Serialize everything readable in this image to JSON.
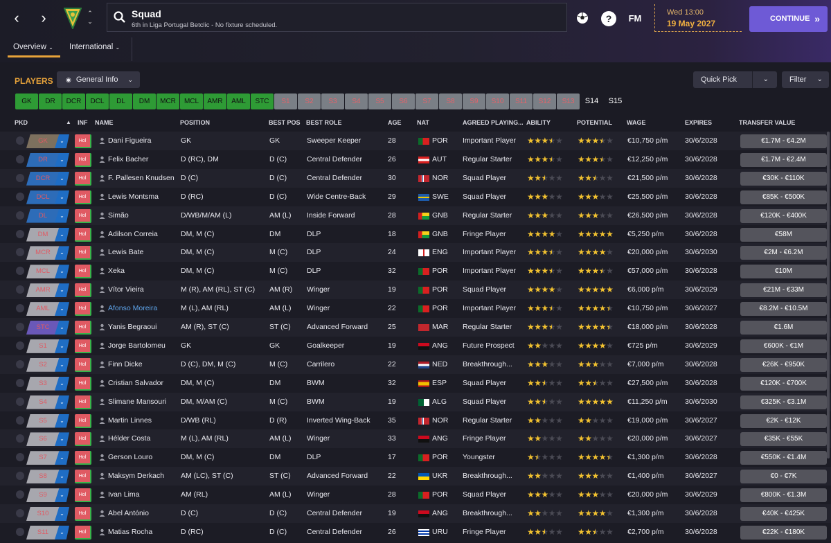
{
  "header": {
    "title": "Squad",
    "subtitle": "6th in Liga Portugal Betclic - No fixture scheduled.",
    "date_line1": "Wed 13:00",
    "date_line2": "19 May 2027",
    "continue_label": "CONTINUE",
    "fm_label": "FM",
    "help_label": "?"
  },
  "subtabs": {
    "overview": "Overview",
    "international": "International"
  },
  "section": {
    "title": "PLAYERS",
    "view_label": "General Info",
    "quickpick_label": "Quick Pick",
    "filter_label": "Filter"
  },
  "colors": {
    "accent": "#e8a33a",
    "continue": "#6e5ad6",
    "chip_green": "#2e9b35",
    "chip_red": "#d2585e",
    "chip_grey": "#7a7f86",
    "star_gold": "#f2c230",
    "star_grey": "#4a4a54"
  },
  "position_chips": [
    {
      "label": "GK",
      "state": "green"
    },
    {
      "label": "DR",
      "state": "green"
    },
    {
      "label": "DCR",
      "state": "green"
    },
    {
      "label": "DCL",
      "state": "green"
    },
    {
      "label": "DL",
      "state": "green"
    },
    {
      "label": "DM",
      "state": "green"
    },
    {
      "label": "MCR",
      "state": "green"
    },
    {
      "label": "MCL",
      "state": "green"
    },
    {
      "label": "AMR",
      "state": "green"
    },
    {
      "label": "AML",
      "state": "green"
    },
    {
      "label": "STC",
      "state": "green"
    },
    {
      "label": "S1",
      "state": "grey"
    },
    {
      "label": "S2",
      "state": "grey"
    },
    {
      "label": "S3",
      "state": "grey"
    },
    {
      "label": "S4",
      "state": "grey"
    },
    {
      "label": "S5",
      "state": "grey"
    },
    {
      "label": "S6",
      "state": "grey"
    },
    {
      "label": "S7",
      "state": "grey"
    },
    {
      "label": "S8",
      "state": "grey"
    },
    {
      "label": "S9",
      "state": "grey"
    },
    {
      "label": "S10",
      "state": "grey"
    },
    {
      "label": "S11",
      "state": "grey"
    },
    {
      "label": "S12",
      "state": "grey"
    },
    {
      "label": "S13",
      "state": "grey"
    },
    {
      "label": "S14",
      "state": "dark"
    },
    {
      "label": "S15",
      "state": "dark"
    }
  ],
  "table": {
    "columns": [
      "PKD",
      "INF",
      "NAME",
      "POSITION",
      "BEST POS",
      "BEST ROLE",
      "AGE",
      "NAT",
      "AGREED PLAYING...",
      "ABILITY",
      "POTENTIAL",
      "WAGE",
      "EXPIRES",
      "TRANSFER VALUE"
    ],
    "rows": [
      {
        "pkd": "GK",
        "pkd_color": "#7d705e",
        "inf": "Hol",
        "name": "Dani Figueira",
        "position": "GK",
        "best_pos": "GK",
        "best_role": "Sweeper Keeper",
        "age": "28",
        "nat": "POR",
        "playing": "Important Player",
        "ability": 3.5,
        "potential": 3.5,
        "wage": "€10,750 p/m",
        "expires": "30/6/2028",
        "value": "€1.7M - €4.2M"
      },
      {
        "pkd": "DR",
        "pkd_color": "#2d6cb8",
        "inf": "Hol",
        "name": "Felix Bacher",
        "position": "D (RC), DM",
        "best_pos": "D (C)",
        "best_role": "Central Defender",
        "age": "26",
        "nat": "AUT",
        "playing": "Regular Starter",
        "ability": 3.5,
        "potential": 3.5,
        "wage": "€12,250 p/m",
        "expires": "30/6/2028",
        "value": "€1.7M - €2.4M"
      },
      {
        "pkd": "DCR",
        "pkd_color": "#2d6cb8",
        "inf": "Hol",
        "name": "F. Pallesen Knudsen",
        "position": "D (C)",
        "best_pos": "D (C)",
        "best_role": "Central Defender",
        "age": "30",
        "nat": "NOR",
        "playing": "Squad Player",
        "ability": 2.5,
        "potential": 2.5,
        "wage": "€21,500 p/m",
        "expires": "30/6/2028",
        "value": "€30K - €110K"
      },
      {
        "pkd": "DCL",
        "pkd_color": "#2d6cb8",
        "inf": "Hol",
        "name": "Lewis Montsma",
        "position": "D (RC)",
        "best_pos": "D (C)",
        "best_role": "Wide Centre-Back",
        "age": "29",
        "nat": "SWE",
        "playing": "Squad Player",
        "ability": 3,
        "potential": 3,
        "wage": "€25,500 p/m",
        "expires": "30/6/2028",
        "value": "€85K - €500K"
      },
      {
        "pkd": "DL",
        "pkd_color": "#2d6cb8",
        "inf": "Hol",
        "name": "Simão",
        "position": "D/WB/M/AM (L)",
        "best_pos": "AM (L)",
        "best_role": "Inside Forward",
        "age": "28",
        "nat": "GNB",
        "playing": "Regular Starter",
        "ability": 3,
        "potential": 3,
        "wage": "€26,500 p/m",
        "expires": "30/6/2028",
        "value": "€120K - €400K"
      },
      {
        "pkd": "DM",
        "pkd_color": "#a7a7ae",
        "inf": "Hol",
        "name": "Adilson Correia",
        "position": "DM, M (C)",
        "best_pos": "DM",
        "best_role": "DLP",
        "age": "18",
        "nat": "GNB",
        "playing": "Fringe Player",
        "ability": 4,
        "potential": 5,
        "wage": "€5,250 p/m",
        "expires": "30/6/2028",
        "value": "€58M"
      },
      {
        "pkd": "MCR",
        "pkd_color": "#a7a7ae",
        "inf": "Hol",
        "name": "Lewis Bate",
        "position": "DM, M (C)",
        "best_pos": "M (C)",
        "best_role": "DLP",
        "age": "24",
        "nat": "ENG",
        "playing": "Important Player",
        "ability": 3.5,
        "potential": 4,
        "wage": "€20,000 p/m",
        "expires": "30/6/2030",
        "value": "€2M - €6.2M"
      },
      {
        "pkd": "MCL",
        "pkd_color": "#a7a7ae",
        "inf": "Hol",
        "name": "Xeka",
        "position": "DM, M (C)",
        "best_pos": "M (C)",
        "best_role": "DLP",
        "age": "32",
        "nat": "POR",
        "playing": "Important Player",
        "ability": 3.5,
        "potential": 3.5,
        "wage": "€57,000 p/m",
        "expires": "30/6/2028",
        "value": "€10M"
      },
      {
        "pkd": "AMR",
        "pkd_color": "#a7a7ae",
        "inf": "Hol",
        "name": "Vítor Vieira",
        "position": "M (R), AM (RL), ST (C)",
        "best_pos": "AM (R)",
        "best_role": "Winger",
        "age": "19",
        "nat": "POR",
        "playing": "Squad Player",
        "ability": 4,
        "potential": 5,
        "wage": "€6,000 p/m",
        "expires": "30/6/2029",
        "value": "€21M - €33M"
      },
      {
        "pkd": "AML",
        "pkd_color": "#a7a7ae",
        "inf": "Hol",
        "name": "Afonso Moreira",
        "position": "M (L), AM (RL)",
        "best_pos": "AM (L)",
        "best_role": "Winger",
        "age": "22",
        "nat": "POR",
        "playing": "Important Player",
        "ability": 3.5,
        "potential": 4.5,
        "wage": "€10,750 p/m",
        "expires": "30/6/2027",
        "value": "€8.2M - €10.5M",
        "highlight": true
      },
      {
        "pkd": "STC",
        "pkd_color": "#6a58b8",
        "inf": "Hol",
        "name": "Yanis Begraoui",
        "position": "AM (R), ST (C)",
        "best_pos": "ST (C)",
        "best_role": "Advanced Forward",
        "age": "25",
        "nat": "MAR",
        "playing": "Regular Starter",
        "ability": 3.5,
        "potential": 4.5,
        "wage": "€18,000 p/m",
        "expires": "30/6/2028",
        "value": "€1.6M"
      },
      {
        "pkd": "S1",
        "pkd_color": "#a7a7ae",
        "inf": "Hol",
        "name": "Jorge Bartolomeu",
        "position": "GK",
        "best_pos": "GK",
        "best_role": "Goalkeeper",
        "age": "19",
        "nat": "ANG",
        "playing": "Future Prospect",
        "ability": 2,
        "potential": 4,
        "wage": "€725 p/m",
        "expires": "30/6/2029",
        "value": "€600K - €1M"
      },
      {
        "pkd": "S2",
        "pkd_color": "#a7a7ae",
        "inf": "Hol",
        "name": "Finn Dicke",
        "position": "D (C), DM, M (C)",
        "best_pos": "M (C)",
        "best_role": "Carrilero",
        "age": "22",
        "nat": "NED",
        "playing": "Breakthrough...",
        "ability": 3,
        "potential": 3,
        "wage": "€7,000 p/m",
        "expires": "30/6/2028",
        "value": "€26K - €950K"
      },
      {
        "pkd": "S3",
        "pkd_color": "#a7a7ae",
        "inf": "Hol",
        "name": "Cristian Salvador",
        "position": "DM, M (C)",
        "best_pos": "DM",
        "best_role": "BWM",
        "age": "32",
        "nat": "ESP",
        "playing": "Squad Player",
        "ability": 2.5,
        "potential": 2.5,
        "wage": "€27,500 p/m",
        "expires": "30/6/2028",
        "value": "€120K - €700K"
      },
      {
        "pkd": "S4",
        "pkd_color": "#a7a7ae",
        "inf": "Hol",
        "name": "Slimane Mansouri",
        "position": "DM, M/AM (C)",
        "best_pos": "M (C)",
        "best_role": "BWM",
        "age": "19",
        "nat": "ALG",
        "playing": "Squad Player",
        "ability": 2.5,
        "potential": 5,
        "wage": "€11,250 p/m",
        "expires": "30/6/2030",
        "value": "€325K - €3.1M"
      },
      {
        "pkd": "S5",
        "pkd_color": "#a7a7ae",
        "inf": "Hol",
        "name": "Martin Linnes",
        "position": "D/WB (RL)",
        "best_pos": "D (R)",
        "best_role": "Inverted Wing-Back",
        "age": "35",
        "nat": "NOR",
        "playing": "Regular Starter",
        "ability": 2,
        "potential": 2,
        "wage": "€19,000 p/m",
        "expires": "30/6/2027",
        "value": "€2K - €12K"
      },
      {
        "pkd": "S6",
        "pkd_color": "#a7a7ae",
        "inf": "Hol",
        "name": "Hélder Costa",
        "position": "M (L), AM (RL)",
        "best_pos": "AM (L)",
        "best_role": "Winger",
        "age": "33",
        "nat": "ANG",
        "playing": "Fringe Player",
        "ability": 2,
        "potential": 2,
        "wage": "€20,000 p/m",
        "expires": "30/6/2027",
        "value": "€35K - €55K"
      },
      {
        "pkd": "S7",
        "pkd_color": "#a7a7ae",
        "inf": "Hol",
        "name": "Gerson Louro",
        "position": "DM, M (C)",
        "best_pos": "DM",
        "best_role": "DLP",
        "age": "17",
        "nat": "POR",
        "playing": "Youngster",
        "ability": 1.5,
        "potential": 4.5,
        "wage": "€1,300 p/m",
        "expires": "30/6/2028",
        "value": "€550K - €1.4M"
      },
      {
        "pkd": "S8",
        "pkd_color": "#a7a7ae",
        "inf": "Hol",
        "name": "Maksym Derkach",
        "position": "AM (LC), ST (C)",
        "best_pos": "ST (C)",
        "best_role": "Advanced Forward",
        "age": "22",
        "nat": "UKR",
        "playing": "Breakthrough...",
        "ability": 2,
        "potential": 3,
        "wage": "€1,400 p/m",
        "expires": "30/6/2027",
        "value": "€0 - €7K"
      },
      {
        "pkd": "S9",
        "pkd_color": "#a7a7ae",
        "inf": "Hol",
        "name": "Ivan Lima",
        "position": "AM (RL)",
        "best_pos": "AM (L)",
        "best_role": "Winger",
        "age": "28",
        "nat": "POR",
        "playing": "Squad Player",
        "ability": 3,
        "potential": 3,
        "wage": "€20,000 p/m",
        "expires": "30/6/2029",
        "value": "€800K - €1.3M"
      },
      {
        "pkd": "S10",
        "pkd_color": "#a7a7ae",
        "inf": "Hol",
        "name": "Abel António",
        "position": "D (C)",
        "best_pos": "D (C)",
        "best_role": "Central Defender",
        "age": "19",
        "nat": "ANG",
        "playing": "Breakthrough...",
        "ability": 2,
        "potential": 4,
        "wage": "€1,300 p/m",
        "expires": "30/6/2028",
        "value": "€40K - €425K"
      },
      {
        "pkd": "S11",
        "pkd_color": "#a7a7ae",
        "inf": "Hol",
        "name": "Matias Rocha",
        "position": "D (RC)",
        "best_pos": "D (C)",
        "best_role": "Central Defender",
        "age": "26",
        "nat": "URU",
        "playing": "Fringe Player",
        "ability": 2.5,
        "potential": 2.5,
        "wage": "€2,700 p/m",
        "expires": "30/6/2028",
        "value": "€22K - €180K"
      }
    ]
  }
}
